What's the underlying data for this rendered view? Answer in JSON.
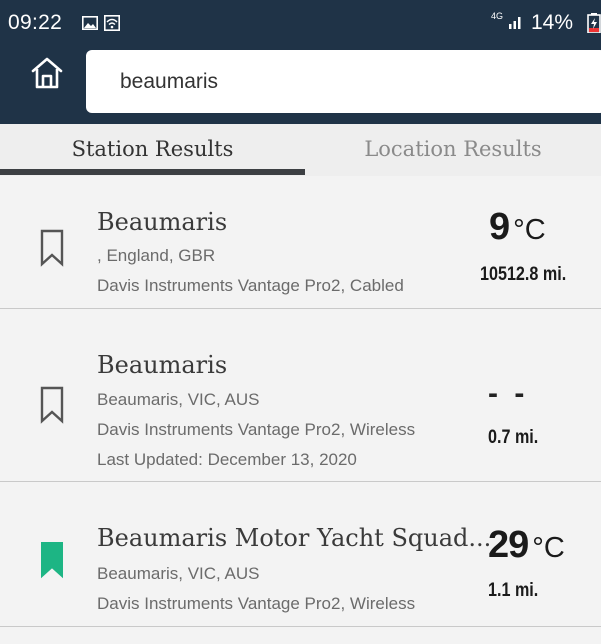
{
  "status_bar": {
    "time": "09:22",
    "network": "4G",
    "battery": "14%",
    "icons": [
      "image-icon",
      "wifi-icon",
      "signal-icon",
      "battery-charging-icon"
    ]
  },
  "header": {
    "home_icon": "home-icon",
    "search_value": "beaumaris"
  },
  "tabs": [
    {
      "label": "Station Results",
      "active": true
    },
    {
      "label": "Location Results",
      "active": false
    }
  ],
  "results": [
    {
      "name": "Beaumaris",
      "location": ", England, GBR",
      "device": "Davis Instruments Vantage Pro2, Cabled",
      "temp_value": "9",
      "temp_unit": "°C",
      "distance": "10512.8 mi.",
      "bookmarked": false
    },
    {
      "name": "Beaumaris",
      "location": "Beaumaris, VIC, AUS",
      "device": "Davis Instruments Vantage Pro2, Wireless",
      "last_updated": "Last Updated: December 13, 2020",
      "temp_value": "- -",
      "distance": "0.7 mi.",
      "bookmarked": false
    },
    {
      "name": "Beaumaris Motor Yacht Squad...",
      "location": "Beaumaris, VIC, AUS",
      "device": "Davis Instruments Vantage Pro2, Wireless",
      "temp_value": "29",
      "temp_unit": "°C",
      "distance": "1.1 mi.",
      "bookmarked": true
    }
  ],
  "colors": {
    "header_bg": "#1f3347",
    "bookmark_active": "#1db584",
    "tab_indicator": "#3c3f43"
  }
}
